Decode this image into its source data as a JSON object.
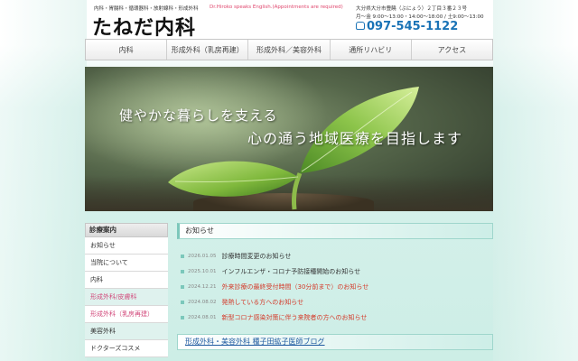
{
  "header": {
    "subjects": "内科・胃腸科・循環器科・放射線科・形成外科",
    "english": "Dr.Hiroko speaks English.(Appointments are required)",
    "logo": "たねだ内科",
    "address": "大分県大分市豊饒（ぶにょう）２丁目３番２３号",
    "hours": "月〜金 9:00〜13:00・14:00〜18:00 / 土9:00〜13:00",
    "phone": "097-545-1122"
  },
  "nav": {
    "items": [
      {
        "label": "内科"
      },
      {
        "label": "形成外科（乳房再建）"
      },
      {
        "label": "形成外科／美容外科"
      },
      {
        "label": "通所リハビリ"
      },
      {
        "label": "アクセス"
      }
    ]
  },
  "hero": {
    "line1": "健やかな暮らしを支える",
    "line2": "心の通う地域医療を目指します"
  },
  "sidebar": {
    "heading": "診療案内",
    "items": [
      {
        "label": "お知らせ"
      },
      {
        "label": "当院について"
      },
      {
        "label": "内科"
      },
      {
        "label": "形成外科/皮膚科"
      },
      {
        "label": "形成外科（乳房再建）"
      },
      {
        "label": "美容外科"
      },
      {
        "label": "ドクターズコスメ"
      }
    ]
  },
  "main": {
    "news_heading": "お知らせ",
    "news": [
      {
        "date": "2026.01.05",
        "title": "診療時間変更のお知らせ"
      },
      {
        "date": "2025.10.01",
        "title": "インフルエンザ・コロナ予防接種開始のお知らせ"
      },
      {
        "date": "2024.12.21",
        "title": "外来診療の最終受付時間（30分前まで）のお知らせ"
      },
      {
        "date": "2024.08.02",
        "title": "発熱している方へのお知らせ"
      },
      {
        "date": "2024.08.01",
        "title": "新型コロナ感染対策に伴う来院者の方へのお知らせ"
      }
    ],
    "blog_banner": "形成外科・美容外科 種子田紘子医師ブログ"
  },
  "colors": {
    "accent": "#7cc8bb",
    "phone": "#1a73b6",
    "pink": "#d2497b",
    "alert": "#d43a2a"
  }
}
